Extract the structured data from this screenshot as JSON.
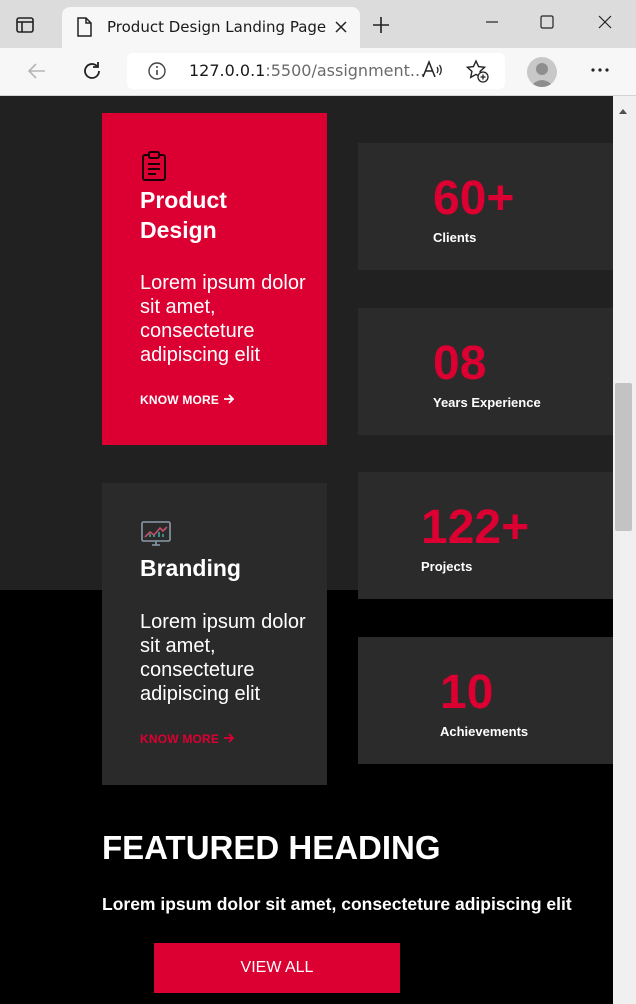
{
  "browser": {
    "tab_title": "Product Design Landing Page",
    "url_host": "127.0.0.1",
    "url_rest": ":5500/assignment...",
    "icons": [
      "tab-actions-icon",
      "page-icon",
      "close-icon",
      "new-tab-icon",
      "minimize-icon",
      "maximize-icon",
      "window-close-icon",
      "back-icon",
      "refresh-icon",
      "info-icon",
      "read-aloud-icon",
      "favorites-icon",
      "profile-icon",
      "more-icon"
    ]
  },
  "cards": [
    {
      "icon": "clipboard-icon",
      "title_line1": "Product",
      "title_line2": "Design",
      "body": [
        "Lorem ipsum dolor",
        "sit amet,",
        "consecteture",
        "adipiscing elit"
      ],
      "link": "KNOW MORE",
      "link_color": "#ffffff"
    },
    {
      "icon": "chart-monitor-icon",
      "title_line1": "Branding",
      "body": [
        "Lorem ipsum dolor",
        "sit amet,",
        "consecteture",
        "adipiscing elit"
      ],
      "link": "KNOW MORE",
      "link_color": "#dc0032"
    }
  ],
  "stats": [
    {
      "value": "60+",
      "label": "Clients"
    },
    {
      "value": "08",
      "label": "Years Experience"
    },
    {
      "value": "122+",
      "label": "Projects"
    },
    {
      "value": "10",
      "label": "Achievements"
    }
  ],
  "featured": {
    "heading": "FEATURED HEADING",
    "subheading": "Lorem ipsum dolor sit amet, consecteture adipiscing elit",
    "button": "VIEW ALL"
  },
  "colors": {
    "accent": "#dc0032",
    "card_dark": "#2a2a2a",
    "band": "#212121"
  }
}
